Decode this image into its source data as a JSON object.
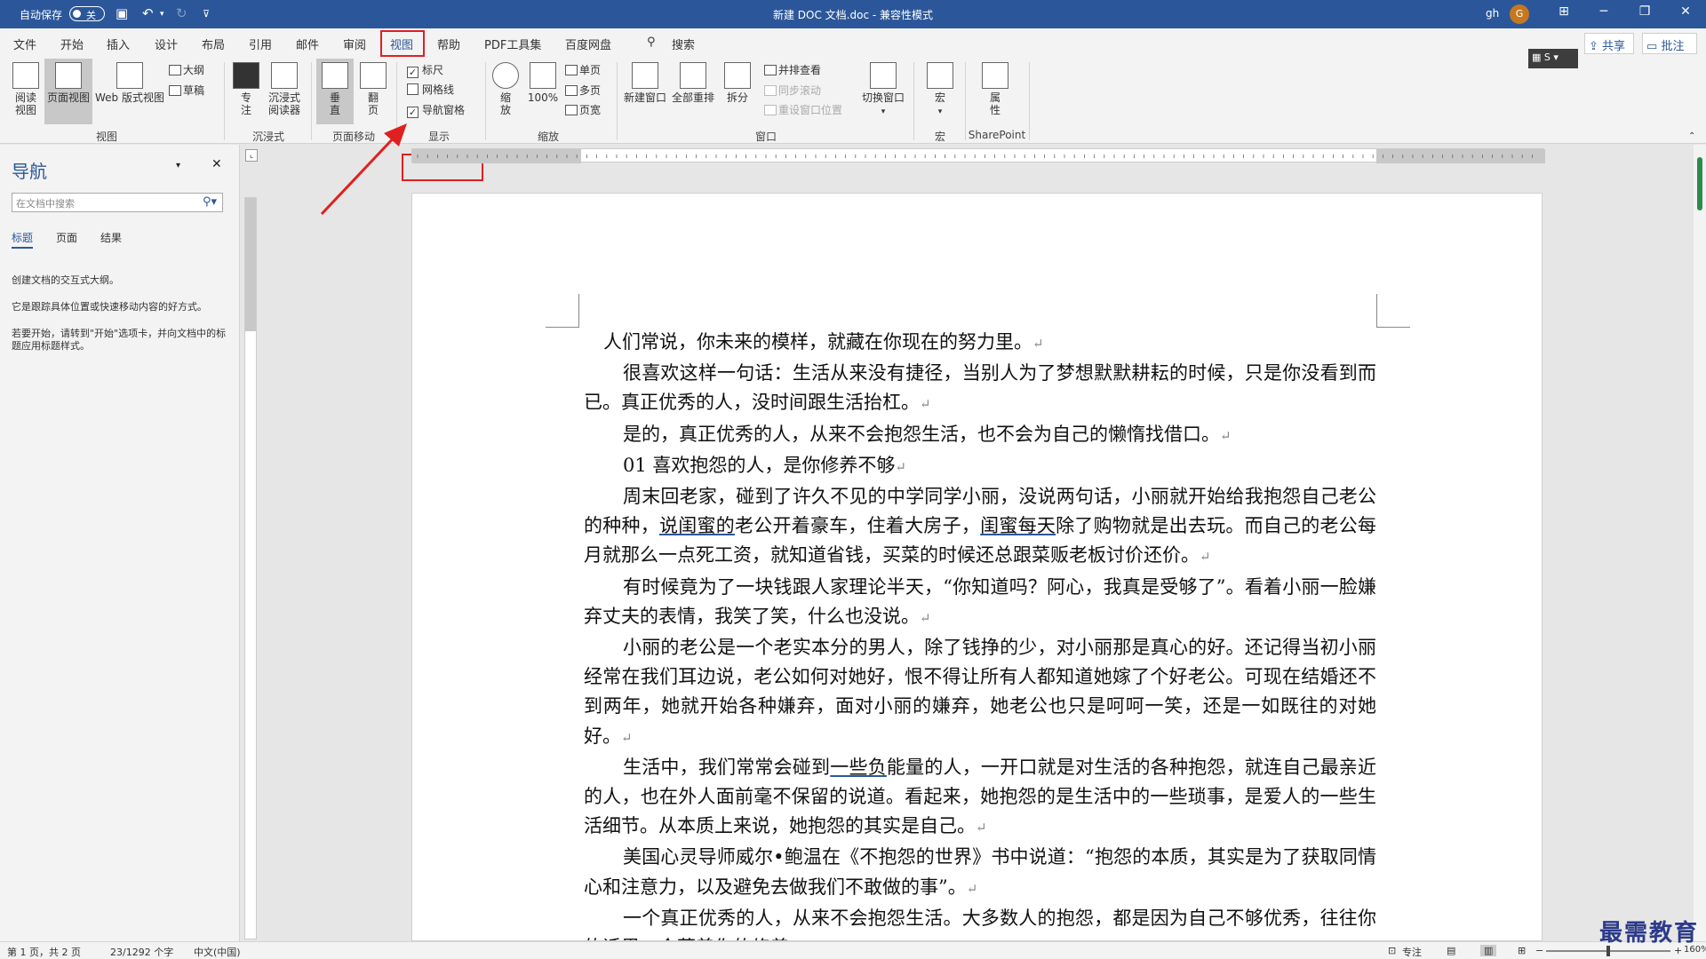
{
  "titlebar": {
    "autosave_label": "自动保存",
    "autosave_state": "关",
    "doc_title": "新建 DOC 文档.doc  -  兼容性模式",
    "user_name": "gh",
    "avatar_letter": "G"
  },
  "tabs": [
    "文件",
    "开始",
    "插入",
    "设计",
    "布局",
    "引用",
    "邮件",
    "审阅",
    "视图",
    "帮助",
    "PDF工具集",
    "百度网盘"
  ],
  "active_tab": "视图",
  "search_label": "搜索",
  "share_label": "共享",
  "comments_label": "批注",
  "ribbon": {
    "views": {
      "read": "阅读\n视图",
      "print": "页面视图",
      "web": "Web 版式视图",
      "outline": "大纲",
      "draft": "草稿",
      "group": "视图"
    },
    "immersive": {
      "focus": "专\n注",
      "reader": "沉浸式\n阅读器",
      "group": "沉浸式"
    },
    "page_move": {
      "vertical": "垂\n直",
      "side": "翻\n页",
      "group": "页面移动"
    },
    "show": {
      "ruler": "标尺",
      "gridlines": "网格线",
      "navpane": "导航窗格",
      "group": "显示",
      "ruler_checked": true,
      "gridlines_checked": false,
      "navpane_checked": true
    },
    "zoom": {
      "zoom": "缩\n放",
      "hundred": "100%",
      "one_page": "单页",
      "multi_page": "多页",
      "page_width": "页宽",
      "group": "缩放"
    },
    "window": {
      "new_window": "新建窗口",
      "arrange_all": "全部重排",
      "split": "拆分",
      "side_by_side": "并排查看",
      "sync_scroll": "同步滚动",
      "reset_pos": "重设窗口位置",
      "switch": "切换窗口",
      "group": "窗口"
    },
    "macros": {
      "macro": "宏",
      "group": "宏"
    },
    "sharepoint": {
      "props": "属\n性",
      "group": "SharePoint"
    }
  },
  "nav": {
    "title": "导航",
    "search_placeholder": "在文档中搜索",
    "tabs": [
      "标题",
      "页面",
      "结果"
    ],
    "msg1": "创建文档的交互式大纲。",
    "msg2": "它是跟踪具体位置或快速移动内容的好方式。",
    "msg3": "若要开始，请转到\"开始\"选项卡，并向文档中的标题应用标题样式。"
  },
  "document": {
    "p1": "人们常说，你未来的模样，就藏在你现在的努力里。",
    "p2": "很喜欢这样一句话：生活从来没有捷径，当别人为了梦想默默耕耘的时候，只是你没看到而已。真正优秀的人，没时间跟生活抬杠。",
    "p3": "是的，真正优秀的人，从来不会抱怨生活，也不会为自己的懒惰找借口。",
    "p4": "01  喜欢抱怨的人，是你修养不够",
    "p5a": "周末回老家，碰到了许久不见的中学同学小丽，没说两句话，小丽就开始给我抱怨自己老公的种种，",
    "p5b": "说闺蜜的",
    "p5c": "老公开着豪车，住着大房子，",
    "p5d": "闺蜜每天",
    "p5e": "除了购物就是出去玩。而自己的老公每月就那么一点死工资，就知道省钱，买菜的时候还总跟菜贩老板讨价还价。",
    "p6": "有时候竟为了一块钱跟人家理论半天，“你知道吗？阿心，我真是受够了”。看着小丽一脸嫌弃丈夫的表情，我笑了笑，什么也没说。",
    "p7": "小丽的老公是一个老实本分的男人，除了钱挣的少，对小丽那是真心的好。还记得当初小丽经常在我们耳边说，老公如何对她好，恨不得让所有人都知道她嫁了个好老公。可现在结婚还不到两年，她就开始各种嫌弃，面对小丽的嫌弃，她老公也只是呵呵一笑，还是一如既往的对她好。",
    "p8a": "生活中，我们常常会碰到",
    "p8b": "一些负",
    "p8c": "能量的人，一开口就是对生活的各种抱怨，就连自己最亲近的人，也在外人面前毫不保留的说道。看起来，她抱怨的是生活中的一些琐事，是爱人的一些生活细节。从本质上来说，她抱怨的其实是自己。",
    "p9": "美国心灵导师威尔•鲍温在《不抱怨的世界》书中说道：“抱怨的本质，其实是为了获取同情心和注意力，以及避免去做我们不敢做的事”。",
    "p10": "一个真正优秀的人，从来不会抱怨生活。大多数人的抱怨，都是因为自己不够优秀，往往你的话里，会藏着你的修养。",
    "return_mark": "↵"
  },
  "statusbar": {
    "page": "第 1 页，共 2 页",
    "words": "23/1292 个字",
    "lang": "中文(中国)",
    "focus": "专注",
    "zoom": "160%"
  },
  "watermark": "最需教育",
  "colors": {
    "accent": "#2b579a",
    "highlight_red": "#e02020",
    "green_scroll": "#2b8a4e"
  }
}
